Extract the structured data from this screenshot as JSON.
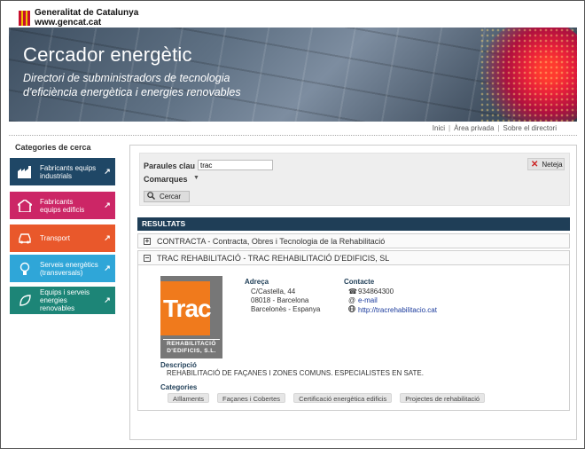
{
  "header": {
    "org_name": "Generalitat de Catalunya",
    "org_url": "www.gencat.cat"
  },
  "banner": {
    "title": "Cercador energètic",
    "subtitle_line1": "Directori de subministradors de tecnologia",
    "subtitle_line2": "d'eficiència energètica i energies renovables"
  },
  "top_links": [
    "Inici",
    "Àrea privada",
    "Sobre el directori"
  ],
  "sidebar": {
    "title": "Categories de cerca",
    "items": [
      {
        "line1": "Fabricants equips",
        "line2": "industrials",
        "color": "#1f4766",
        "icon": "factory-icon"
      },
      {
        "line1": "Fabricants",
        "line2": "equips edificis",
        "color": "#cc2666",
        "icon": "house-icon"
      },
      {
        "line1": "Transport",
        "line2": "",
        "color": "#e9582b",
        "icon": "car-icon"
      },
      {
        "line1": "Serveis energètics",
        "line2": "(transversals)",
        "color": "#2fa6d8",
        "icon": "bulb-icon"
      },
      {
        "line1": "Equips i serveis",
        "line2": "energies renovables",
        "color": "#1d8577",
        "icon": "leaf-icon"
      }
    ],
    "arrow": "↗"
  },
  "search": {
    "keywords_label": "Paraules clau",
    "keywords_value": "trac",
    "regions_label": "Comarques",
    "search_button": "Cercar",
    "reset_button": "Neteja"
  },
  "results": {
    "header": "RESULTATS",
    "items": [
      {
        "toggle": "+",
        "title": "CONTRACTA - Contracta, Obres i Tecnologia de la Rehabilitació"
      },
      {
        "toggle": "−",
        "title": "TRAC REHABILITACIÓ - TRAC REHABILITACIÓ D'EDIFICIS, SL"
      }
    ],
    "detail": {
      "logo_text": "Trac",
      "logo_sub1": "REHABILITACIÓ",
      "logo_sub2": "D'EDIFICIS, S.L.",
      "address_label": "Adreça",
      "address_lines": [
        "C/Castella, 44",
        "08018 - Barcelona",
        "Barcelonès - Espanya"
      ],
      "contact_label": "Contacte",
      "phone": "934864300",
      "email": "e-mail",
      "website": "http://tracrehabilitacio.cat",
      "description_label": "Descripció",
      "description": "REHABILITACIÓ DE FAÇANES I ZONES COMUNS. ESPECIALISTES EN SATE.",
      "categories_label": "Categories",
      "categories": [
        "Aïllaments",
        "Façanes i Cobertes",
        "Certificació energètica edificis",
        "Projectes de rehabilitació"
      ]
    }
  }
}
